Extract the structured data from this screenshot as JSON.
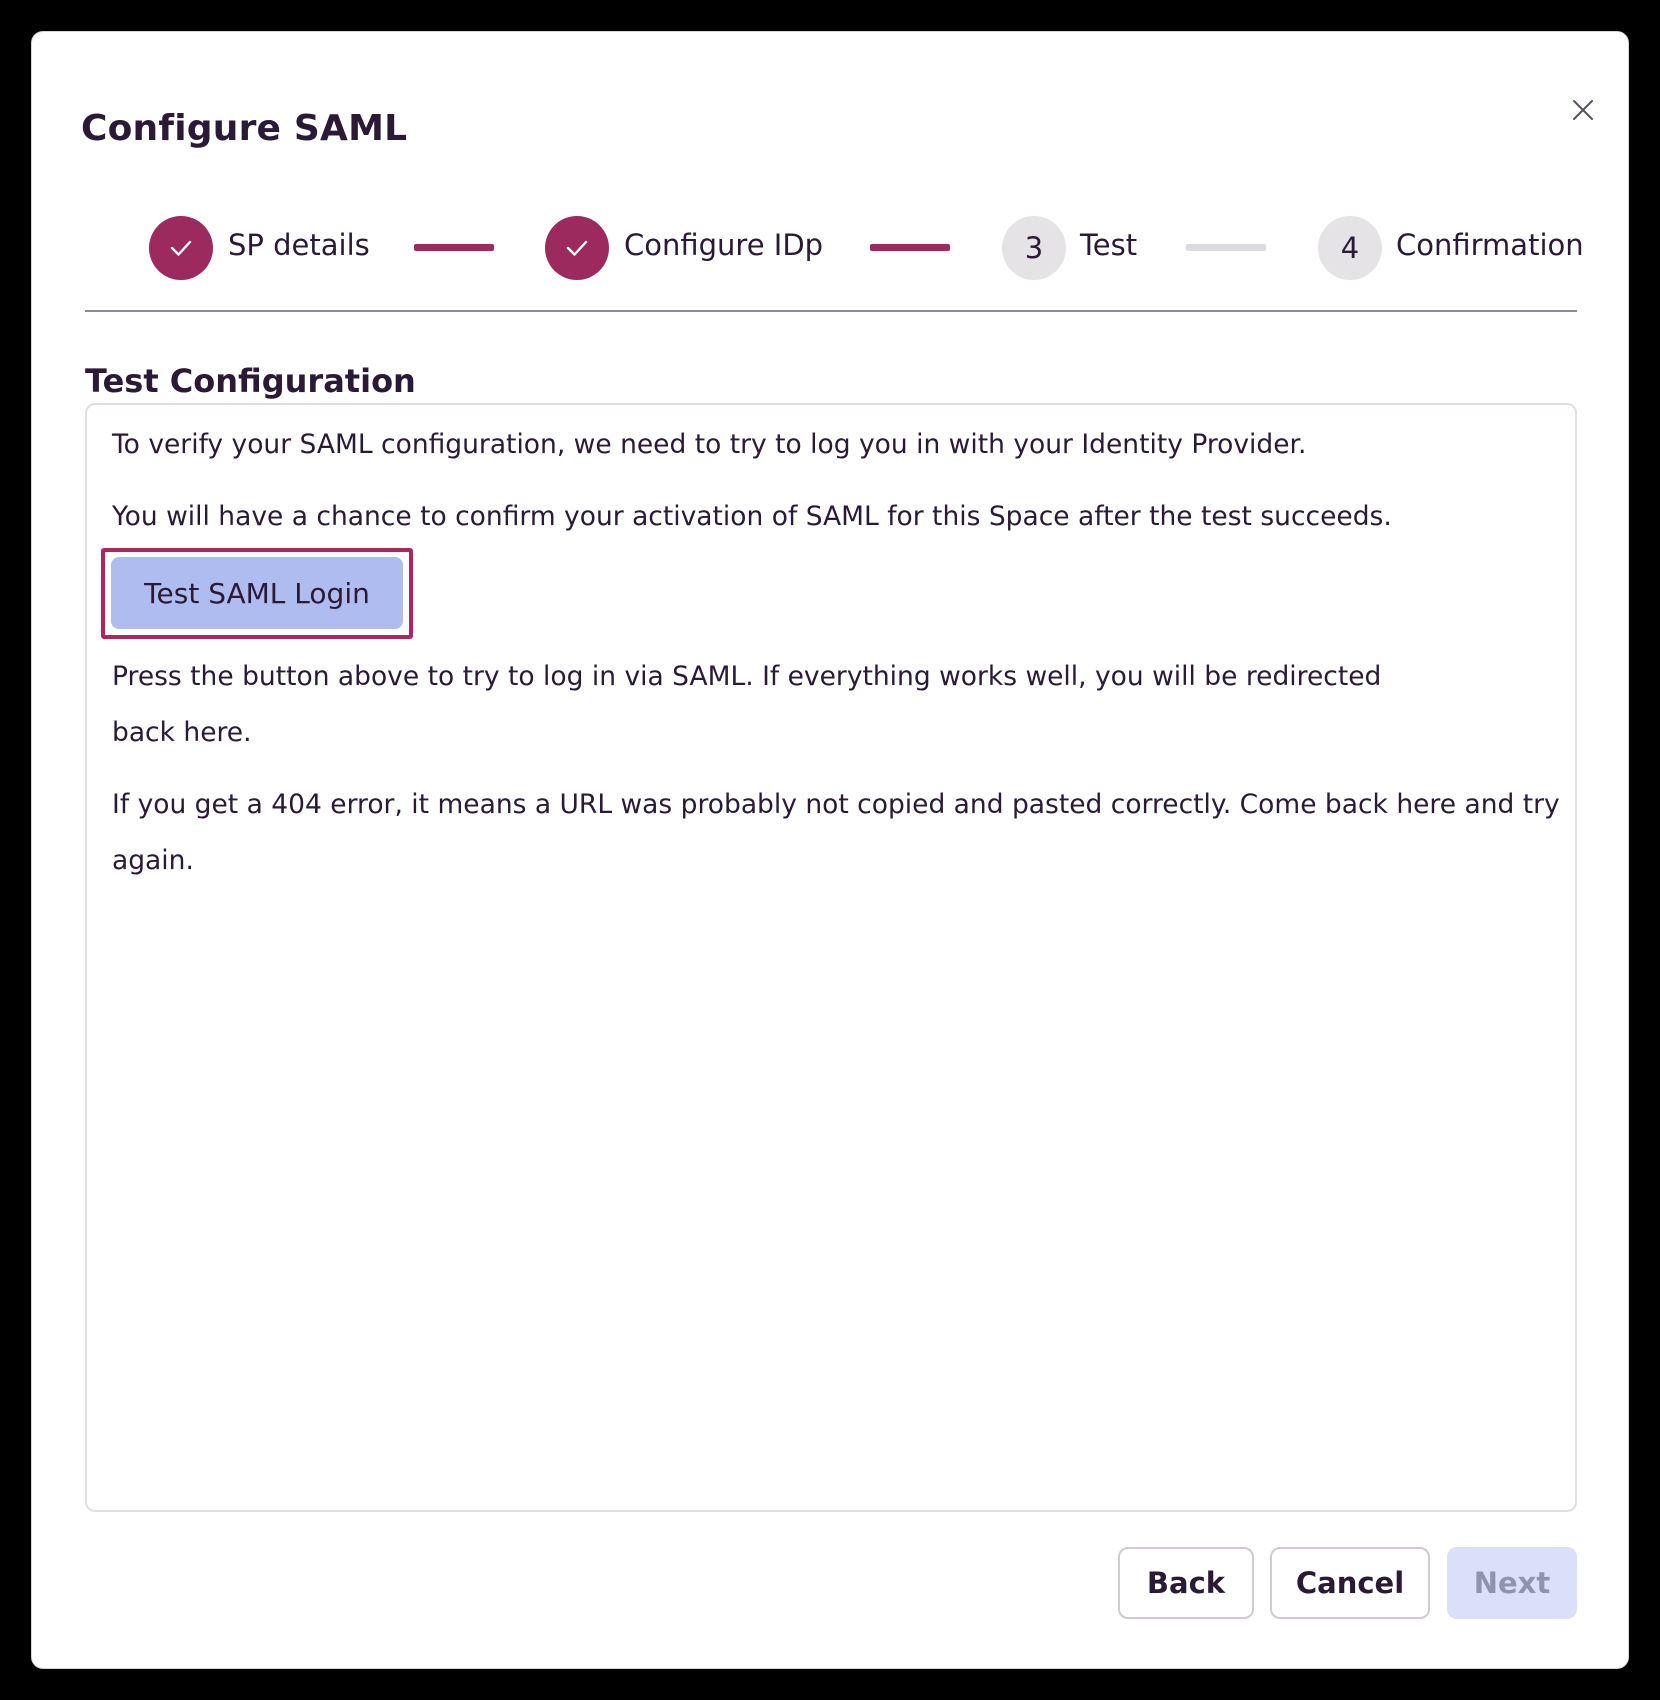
{
  "dialog": {
    "title": "Configure SAML"
  },
  "stepper": {
    "steps": [
      {
        "number": "",
        "label": "SP details",
        "state": "complete"
      },
      {
        "number": "",
        "label": "Configure IDp",
        "state": "complete"
      },
      {
        "number": "3",
        "label": "Test",
        "state": "current"
      },
      {
        "number": "4",
        "label": "Confirmation",
        "state": "upcoming"
      }
    ]
  },
  "section": {
    "heading": "Test Configuration",
    "paragraph_1": "To verify your SAML configuration, we need to try to log you in with your Identity Provider.",
    "paragraph_2": "You will have a chance to confirm your activation of SAML for this Space after the test succeeds.",
    "test_button_label": "Test SAML Login",
    "paragraph_3": "Press the button above to try to log in via SAML. If everything works well, you will be redirected back here.",
    "paragraph_4": "If you get a 404 error, it means a URL was probably not copied and pasted correctly. Come back here and try again."
  },
  "footer": {
    "back_label": "Back",
    "cancel_label": "Cancel",
    "next_label": "Next"
  },
  "colors": {
    "accent": "#9c2a5e",
    "highlight_border": "#b0255f",
    "test_button_bg": "#aebcf0",
    "next_disabled_bg": "#d9e0f7",
    "text": "#2b1a35"
  }
}
